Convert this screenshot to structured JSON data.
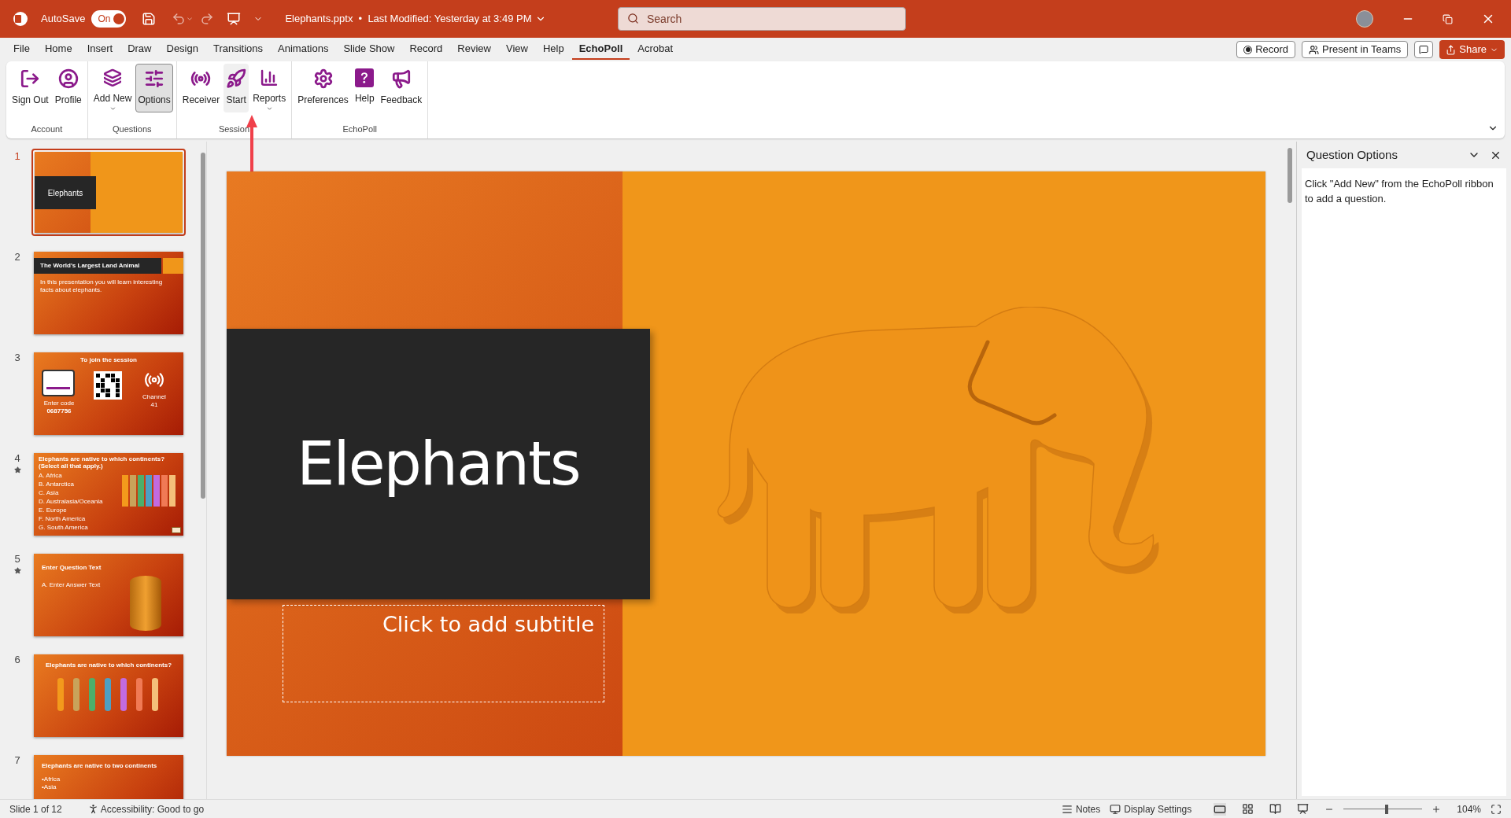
{
  "title_bar": {
    "autosave_label": "AutoSave",
    "autosave": {
      "on": true,
      "label": "On"
    },
    "document_title": "Elephants.pptx  •  Last Modified: Yesterday at 3:49 PM",
    "search": {
      "placeholder": "Search"
    }
  },
  "menu_tabs": [
    {
      "label": "File",
      "selected": false
    },
    {
      "label": "Home",
      "selected": false
    },
    {
      "label": "Insert",
      "selected": false
    },
    {
      "label": "Draw",
      "selected": false
    },
    {
      "label": "Design",
      "selected": false
    },
    {
      "label": "Transitions",
      "selected": false
    },
    {
      "label": "Animations",
      "selected": false
    },
    {
      "label": "Slide Show",
      "selected": false
    },
    {
      "label": "Record",
      "selected": false
    },
    {
      "label": "Review",
      "selected": false
    },
    {
      "label": "View",
      "selected": false
    },
    {
      "label": "Help",
      "selected": false
    },
    {
      "label": "EchoPoll",
      "selected": true
    },
    {
      "label": "Acrobat",
      "selected": false
    }
  ],
  "menu_actions": {
    "record": "Record",
    "present": "Present in Teams",
    "share": "Share"
  },
  "ribbon_groups": [
    {
      "name": "Account",
      "buttons": [
        {
          "label": "Sign Out",
          "dropdown": false,
          "pressed": false,
          "hovered": false
        },
        {
          "label": "Profile",
          "dropdown": false,
          "pressed": false,
          "hovered": false
        }
      ]
    },
    {
      "name": "Questions",
      "buttons": [
        {
          "label": "Add New",
          "dropdown": true,
          "pressed": false,
          "hovered": false
        },
        {
          "label": "Options",
          "dropdown": false,
          "pressed": true,
          "hovered": false
        }
      ]
    },
    {
      "name": "Session",
      "buttons": [
        {
          "label": "Receiver",
          "dropdown": false,
          "pressed": false,
          "hovered": false
        },
        {
          "label": "Start",
          "dropdown": false,
          "pressed": false,
          "hovered": true
        },
        {
          "label": "Reports",
          "dropdown": true,
          "pressed": false,
          "hovered": false
        }
      ]
    },
    {
      "name": "EchoPoll",
      "buttons": [
        {
          "label": "Preferences",
          "dropdown": false,
          "pressed": false,
          "hovered": false
        },
        {
          "label": "Help",
          "dropdown": false,
          "pressed": false,
          "hovered": false
        },
        {
          "label": "Feedback",
          "dropdown": false,
          "pressed": false,
          "hovered": false
        }
      ]
    }
  ],
  "slides": [
    {
      "number": "1",
      "selected": true,
      "starred": false,
      "kind": "title",
      "texts": [
        "Elephants"
      ]
    },
    {
      "number": "2",
      "selected": false,
      "starred": false,
      "kind": "banner",
      "texts": [
        "The World's Largest Land Animal",
        "In this presentation you will learn interesting facts about elephants."
      ]
    },
    {
      "number": "3",
      "selected": false,
      "starred": false,
      "kind": "join",
      "texts": [
        "To join the session",
        "Enter code",
        "0687756",
        "Channel",
        "41"
      ]
    },
    {
      "number": "4",
      "selected": false,
      "starred": true,
      "kind": "bars",
      "texts": [
        "Elephants are native to which continents? (Select all that apply.)",
        "A.  Africa",
        "B.  Antarctica",
        "C.  Asia",
        "D.  Australasia/Oceania",
        "E.  Europe",
        "F.  North America",
        "G.  South America"
      ]
    },
    {
      "number": "5",
      "selected": false,
      "starred": true,
      "kind": "cylinder",
      "texts": [
        "Enter Question Text",
        "A.  Enter Answer Text"
      ]
    },
    {
      "number": "6",
      "selected": false,
      "starred": false,
      "kind": "cylinders",
      "texts": [
        "Elephants are native to which continents?"
      ]
    },
    {
      "number": "7",
      "selected": false,
      "starred": false,
      "kind": "bullets",
      "texts": [
        "Elephants are native to two continents",
        "•Africa",
        "•Asia"
      ]
    }
  ],
  "current_slide": {
    "title": "Elephants",
    "subtitle_placeholder": "Click to add subtitle"
  },
  "task_pane": {
    "title": "Question Options",
    "message": "Click \"Add New\" from the EchoPoll ribbon to add a question."
  },
  "status_bar": {
    "slide_position": "Slide 1 of 12",
    "accessibility": "Accessibility: Good to go",
    "notes": "Notes",
    "display_settings": "Display Settings",
    "zoom": {
      "level": 0.55,
      "label": "104%"
    }
  }
}
